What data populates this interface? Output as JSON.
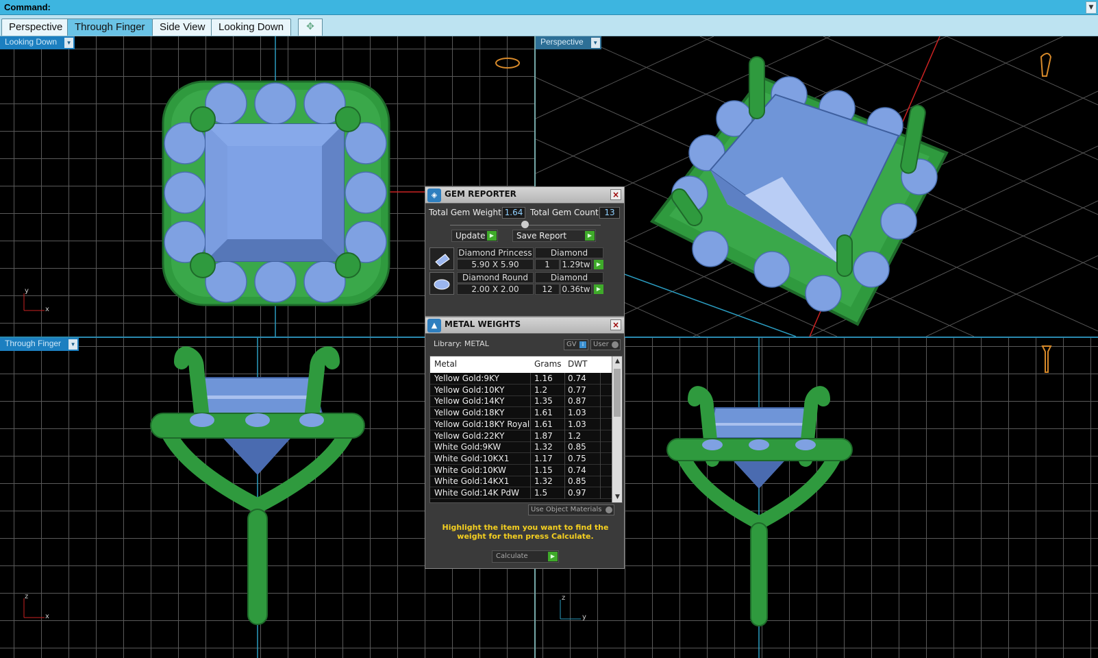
{
  "command": {
    "label": "Command:",
    "value": ""
  },
  "tabs": [
    "Perspective",
    "Through Finger",
    "Side View",
    "Looking Down"
  ],
  "active_tab": 1,
  "viewports": {
    "top_left": {
      "label": "Looking Down",
      "axis_v": "y",
      "axis_h": "x"
    },
    "top_right": {
      "label": "Perspective"
    },
    "bottom_left": {
      "label": "Through Finger",
      "axis_v": "z",
      "axis_h": "x"
    },
    "bottom_right": {
      "axis_v": "z",
      "axis_h": "y"
    }
  },
  "gem_reporter": {
    "title": "GEM REPORTER",
    "total_weight_label": "Total Gem Weight",
    "total_weight": "1.64",
    "total_count_label": "Total Gem Count",
    "total_count": "13",
    "update_label": "Update",
    "save_label": "Save Report",
    "gems": [
      {
        "name": "Diamond Princess",
        "material": "Diamond",
        "size": "5.90 X 5.90",
        "count": "1",
        "weight": "1.29tw",
        "thumb_icon": "princess-gem-icon"
      },
      {
        "name": "Diamond Round",
        "material": "Diamond",
        "size": "2.00 X 2.00",
        "count": "12",
        "weight": "0.36tw",
        "thumb_icon": "round-gem-icon"
      }
    ]
  },
  "metal_weights": {
    "title": "METAL WEIGHTS",
    "library_label": "Library: METAL",
    "gv_label": "GV",
    "user_label": "User",
    "columns": [
      "Metal",
      "Grams",
      "DWT"
    ],
    "rows": [
      [
        "Yellow Gold:9KY",
        "1.16",
        "0.74"
      ],
      [
        "Yellow Gold:10KY",
        "1.2",
        "0.77"
      ],
      [
        "Yellow Gold:14KY",
        "1.35",
        "0.87"
      ],
      [
        "Yellow Gold:18KY",
        "1.61",
        "1.03"
      ],
      [
        "Yellow Gold:18KY Royal",
        "1.61",
        "1.03"
      ],
      [
        "Yellow Gold:22KY",
        "1.87",
        "1.2"
      ],
      [
        "White Gold:9KW",
        "1.32",
        "0.85"
      ],
      [
        "White Gold:10KX1",
        "1.17",
        "0.75"
      ],
      [
        "White Gold:10KW",
        "1.15",
        "0.74"
      ],
      [
        "White Gold:14KX1",
        "1.32",
        "0.85"
      ],
      [
        "White Gold:14K PdW",
        "1.5",
        "0.97"
      ]
    ],
    "use_object_materials_label": "Use Object Materials",
    "hint": "Highlight the item you want to find the weight for then press Calculate.",
    "calculate_label": "Calculate"
  },
  "colors": {
    "command_bar": "#3db5e0",
    "tab_active": "#6ac3e6",
    "metal_green": "#2f9a3e",
    "gem_blue": "#6f95d8",
    "hint_yellow": "#f5d020"
  }
}
